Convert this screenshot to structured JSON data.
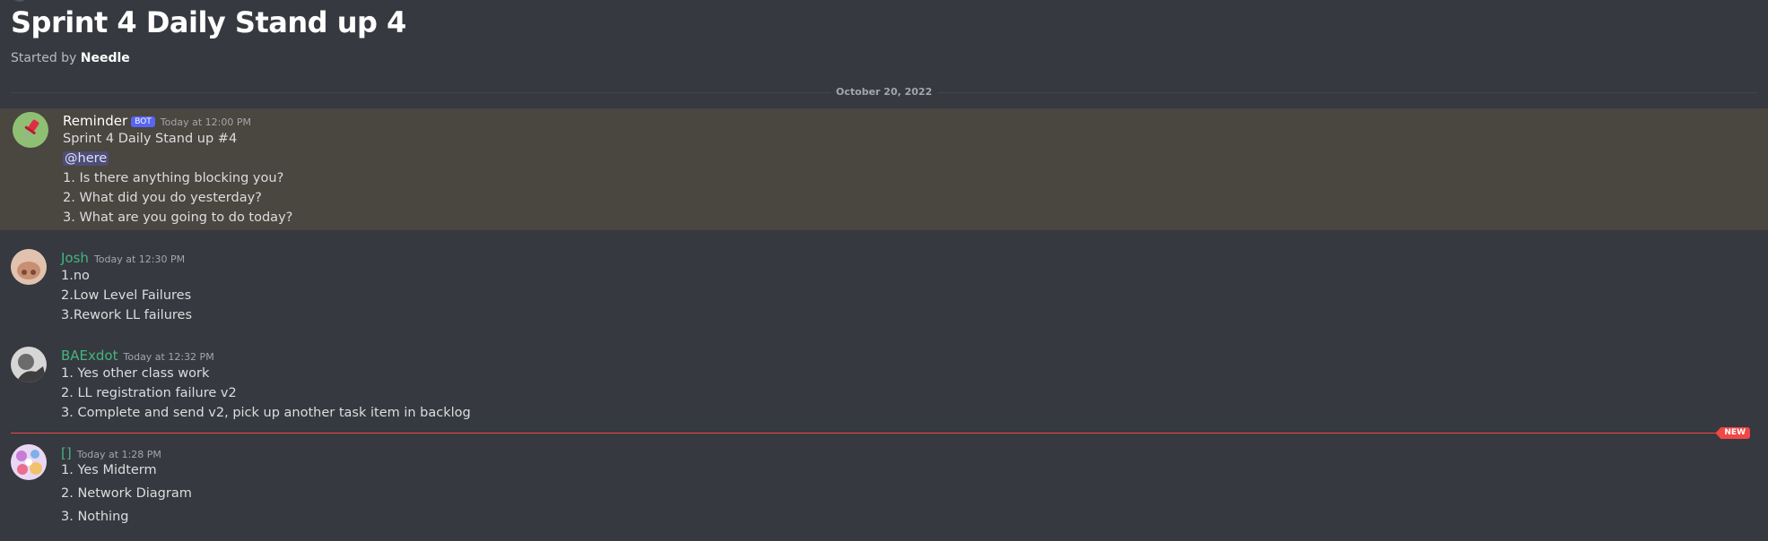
{
  "thread": {
    "title": "Sprint 4 Daily Stand up 4",
    "started_by_prefix": "Started by",
    "started_by_name": "Needle"
  },
  "date_divider": "October 20, 2022",
  "messages": [
    {
      "author": "Reminder",
      "badge": "BOT",
      "timestamp": "Today at 12:00 PM",
      "author_color": "#ffffff",
      "lines": [
        "Sprint 4 Daily Stand up #4",
        "@here",
        "1. Is there anything blocking you?",
        "2. What did you do yesterday?",
        "3. What are you going to do today?"
      ]
    },
    {
      "author": "Josh",
      "timestamp": "Today at 12:30 PM",
      "author_color": "#43b581",
      "lines": [
        "1.no",
        "2.Low Level Failures",
        "3.Rework LL failures"
      ]
    },
    {
      "author": "BAExdot",
      "timestamp": "Today at 12:32 PM",
      "author_color": "#43b581",
      "lines": [
        "1. Yes other class work",
        "2. LL registration failure v2",
        "3. Complete and send v2, pick up another task item in backlog"
      ]
    },
    {
      "author": "[]",
      "timestamp": "Today at 1:28 PM",
      "author_color": "#43b581",
      "lines": [
        "1. Yes Midterm",
        "2. Network Diagram",
        "3. Nothing"
      ]
    }
  ],
  "new_badge": "NEW",
  "colors": {
    "background": "#36393f",
    "highlight": "#4a4640",
    "new_marker": "#f04747",
    "bot_badge": "#5865f2"
  }
}
